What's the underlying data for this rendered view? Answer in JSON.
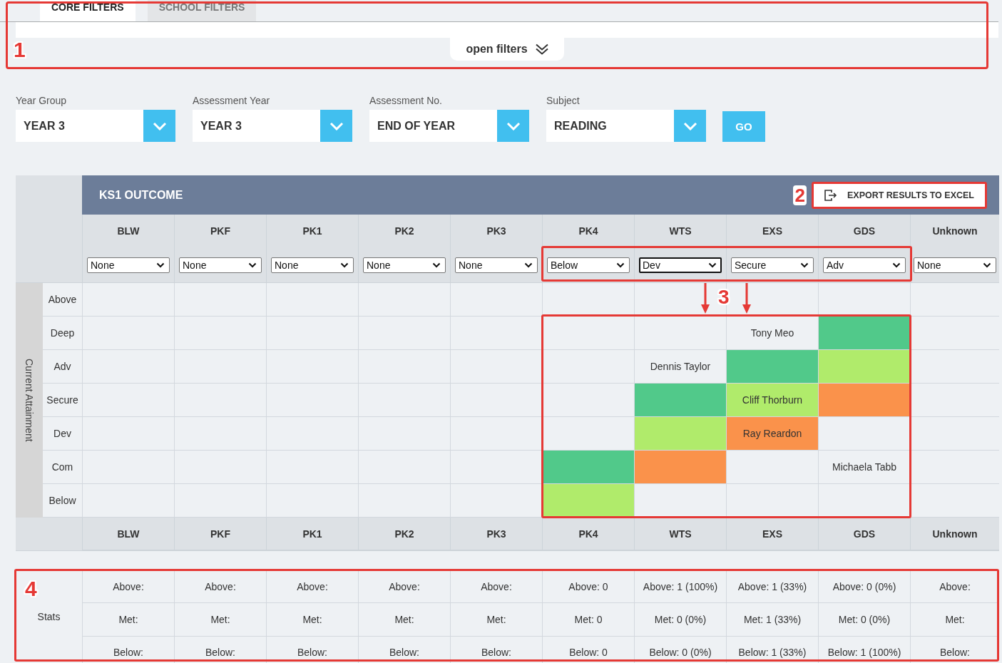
{
  "filter_panel": {
    "tabs": [
      {
        "label": "CORE FILTERS",
        "selected": true
      },
      {
        "label": "SCHOOL FILTERS",
        "selected": false
      }
    ],
    "toggle_button": "open filters"
  },
  "selectors": [
    {
      "label": "Year Group",
      "value": "YEAR 3"
    },
    {
      "label": "Assessment Year",
      "value": "YEAR 3"
    },
    {
      "label": "Assessment No.",
      "value": "END OF YEAR"
    },
    {
      "label": "Subject",
      "value": "READING"
    }
  ],
  "go_button": "GO",
  "outcome_table": {
    "title": "KS1 OUTCOME",
    "export_button": "EXPORT RESULTS TO EXCEL",
    "columns": [
      {
        "label": "BLW",
        "filter": "None",
        "focused": false
      },
      {
        "label": "PKF",
        "filter": "None",
        "focused": false
      },
      {
        "label": "PK1",
        "filter": "None",
        "focused": false
      },
      {
        "label": "PK2",
        "filter": "None",
        "focused": false
      },
      {
        "label": "PK3",
        "filter": "None",
        "focused": false
      },
      {
        "label": "PK4",
        "filter": "Below",
        "focused": false
      },
      {
        "label": "WTS",
        "filter": "Dev",
        "focused": true
      },
      {
        "label": "EXS",
        "filter": "Secure",
        "focused": false
      },
      {
        "label": "GDS",
        "filter": "Adv",
        "focused": false
      },
      {
        "label": "Unknown",
        "filter": "None",
        "focused": false
      }
    ],
    "axis_label": "Current Attainment",
    "rows": [
      {
        "label": "Above",
        "cells": [
          {},
          {},
          {},
          {},
          {},
          {},
          {},
          {},
          {},
          {}
        ]
      },
      {
        "label": "Deep",
        "cells": [
          {},
          {},
          {},
          {},
          {},
          {},
          {},
          {
            "text": "Tony Meo"
          },
          {
            "color": "#51c98a"
          },
          {}
        ]
      },
      {
        "label": "Adv",
        "cells": [
          {},
          {},
          {},
          {},
          {},
          {},
          {
            "text": "Dennis Taylor"
          },
          {
            "color": "#51c98a"
          },
          {
            "color": "#b0eb6b"
          },
          {}
        ]
      },
      {
        "label": "Secure",
        "cells": [
          {},
          {},
          {},
          {},
          {},
          {},
          {
            "color": "#51c98a"
          },
          {
            "text": "Cliff Thorburn",
            "color": "#b0eb6b"
          },
          {
            "color": "#fa924b"
          },
          {}
        ]
      },
      {
        "label": "Dev",
        "cells": [
          {},
          {},
          {},
          {},
          {},
          {},
          {
            "color": "#b0eb6b"
          },
          {
            "text": "Ray Reardon",
            "color": "#fa924b"
          },
          {},
          {}
        ]
      },
      {
        "label": "Com",
        "cells": [
          {},
          {},
          {},
          {},
          {},
          {
            "color": "#51c98a"
          },
          {
            "color": "#fa924b"
          },
          {},
          {
            "text": "Michaela Tabb"
          },
          {}
        ]
      },
      {
        "label": "Below",
        "cells": [
          {},
          {},
          {},
          {},
          {},
          {
            "color": "#b0eb6b"
          },
          {},
          {},
          {},
          {}
        ]
      }
    ],
    "footer": [
      "BLW",
      "PKF",
      "PK1",
      "PK2",
      "PK3",
      "PK4",
      "WTS",
      "EXS",
      "GDS",
      "Unknown"
    ]
  },
  "stats": {
    "label": "Stats",
    "rows": [
      [
        "Above:",
        "Above:",
        "Above:",
        "Above:",
        "Above:",
        "Above: 0",
        "Above: 1 (100%)",
        "Above: 1 (33%)",
        "Above: 0 (0%)",
        "Above:"
      ],
      [
        "Met:",
        "Met:",
        "Met:",
        "Met:",
        "Met:",
        "Met: 0",
        "Met: 0 (0%)",
        "Met: 1 (33%)",
        "Met: 0 (0%)",
        "Met:"
      ],
      [
        "Below:",
        "Below:",
        "Below:",
        "Below:",
        "Below:",
        "Below: 0",
        "Below: 0 (0%)",
        "Below: 1 (33%)",
        "Below: 1 (100%)",
        "Below:"
      ]
    ]
  },
  "annotations": [
    {
      "label": "1"
    },
    {
      "label": "2"
    },
    {
      "label": "3"
    },
    {
      "label": "4"
    }
  ]
}
